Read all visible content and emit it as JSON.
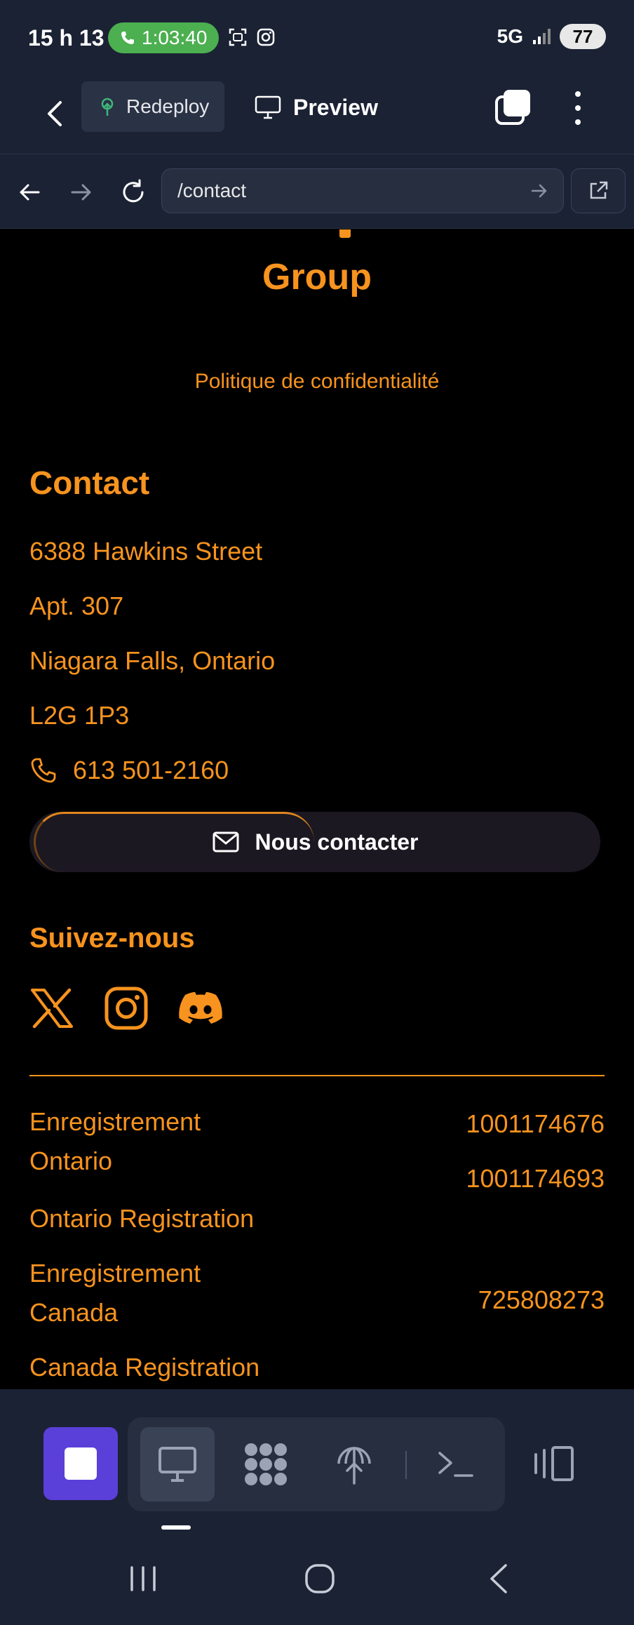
{
  "status_bar": {
    "time": "15 h 13",
    "call_timer": "1:03:40",
    "network": "5G",
    "battery": "77"
  },
  "toolbar": {
    "redeploy_label": "Redeploy",
    "preview_label": "Preview"
  },
  "url_bar": {
    "url": "/contact"
  },
  "page": {
    "group_title": "Group",
    "privacy_link": "Politique de confidentialité",
    "contact_heading": "Contact",
    "address": [
      "6388 Hawkins Street",
      "Apt. 307",
      "Niagara Falls, Ontario",
      "L2G 1P3"
    ],
    "phone": "613 501-2160",
    "contact_button": "Nous contacter",
    "follow_heading": "Suivez-nous",
    "social": [
      "x-icon",
      "instagram-icon",
      "discord-icon"
    ],
    "registrations": {
      "ontario_label_line1": "Enregistrement",
      "ontario_label_line2": "Ontario",
      "ontario_value_1": "1001174676",
      "ontario_value_2": "1001174693",
      "ontario_en": "Ontario Registration",
      "canada_label_line1": "Enregistrement",
      "canada_label_line2": "Canada",
      "canada_value": "725808273",
      "canada_en": "Canada Registration"
    }
  },
  "colors": {
    "accent": "#f7931e",
    "chrome": "#1b2234",
    "stop": "#5b3fd9",
    "call": "#4caf50"
  }
}
